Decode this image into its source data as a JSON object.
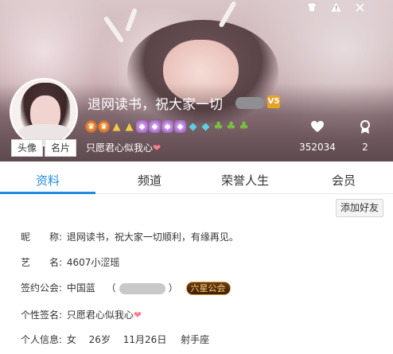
{
  "window": {
    "controls": [
      "skin-icon",
      "warning-icon",
      "close-icon"
    ]
  },
  "profile": {
    "nickname": "退网读书，祝大家一切",
    "level_badge": "V5",
    "signature": "只愿君心似我心",
    "avatar_tab": "头像",
    "card_tab": "名片",
    "likes": "352034",
    "rank_count": "2",
    "medals": [
      "crown",
      "crown",
      "gold",
      "gold",
      "purple",
      "purple",
      "purple",
      "purple",
      "cyan",
      "cyan",
      "leaf",
      "leaf",
      "leaf"
    ]
  },
  "tabs": [
    {
      "label": "资料",
      "active": true
    },
    {
      "label": "频道",
      "active": false
    },
    {
      "label": "荣誉人生",
      "active": false
    },
    {
      "label": "会员",
      "active": false
    }
  ],
  "actions": {
    "add_friend": "添加好友"
  },
  "info": {
    "nickname_label": "昵　　称:",
    "nickname_value": "退网读书，祝大家一切顺利，有缘再见。",
    "art_name_label": "艺　　名:",
    "art_name_value": "4607小涩瑶",
    "union_label": "签约公会:",
    "union_value": "中国蓝",
    "union_open": "（",
    "union_close": "）",
    "union_badge": "六星公会",
    "sign_label": "个性签名:",
    "sign_value": "只愿君心似我心",
    "personal_label": "个人信息:",
    "gender": "女",
    "age": "26岁",
    "birthday": "11月26日",
    "zodiac": "射手座"
  },
  "colors": {
    "accent": "#1f8ce0",
    "heart": "#ff7d8a",
    "union_badge": "#ffd46b"
  }
}
